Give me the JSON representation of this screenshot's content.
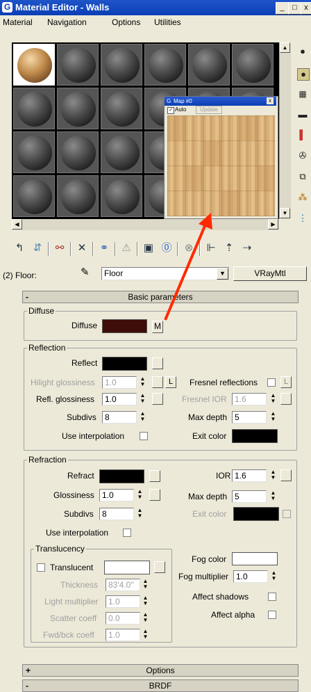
{
  "window": {
    "title": "Material Editor - Walls",
    "app_icon": "3dsmax-logo-icon"
  },
  "menu": [
    "Material",
    "Navigation",
    "Options",
    "Utilities"
  ],
  "map_window": {
    "title": "Map #0",
    "auto_label": "Auto",
    "update_label": "Update"
  },
  "material": {
    "slot_label": "(2) Floor:",
    "name": "Floor",
    "type": "VRayMtl"
  },
  "rollouts": {
    "basic": "Basic parameters",
    "options": "Options",
    "brdf": "BRDF"
  },
  "diffuse": {
    "group": "Diffuse",
    "label": "Diffuse",
    "map_button": "M",
    "color": "#3e0d09"
  },
  "reflection": {
    "group": "Reflection",
    "reflect": "Reflect",
    "hilight_glossiness": "Hilight glossiness",
    "hilight_value": "1.0",
    "lock_label": "L",
    "fresnel": "Fresnel reflections",
    "fresnel_lock": "L",
    "refl_glossiness": "Refl. glossiness",
    "refl_glossiness_value": "1.0",
    "fresnel_ior": "Fresnel IOR",
    "fresnel_ior_value": "1.6",
    "subdivs": "Subdivs",
    "subdivs_value": "8",
    "max_depth": "Max depth",
    "max_depth_value": "5",
    "use_interpolation": "Use interpolation",
    "exit_color": "Exit color"
  },
  "refraction": {
    "group": "Refraction",
    "refract": "Refract",
    "ior": "IOR",
    "ior_value": "1.6",
    "glossiness": "Glossiness",
    "glossiness_value": "1.0",
    "max_depth": "Max depth",
    "max_depth_value": "5",
    "subdivs": "Subdivs",
    "subdivs_value": "8",
    "exit_color": "Exit color",
    "use_interpolation": "Use interpolation"
  },
  "translucency": {
    "group": "Translucency",
    "translucent": "Translucent",
    "thickness": "Thickness",
    "thickness_value": "83'4.0\"",
    "light_multiplier": "Light multiplier",
    "light_multiplier_value": "1.0",
    "scatter_coeff": "Scatter coeff",
    "scatter_coeff_value": "0.0",
    "fwd_bck_coeff": "Fwd/bck coeff",
    "fwd_bck_coeff_value": "1.0",
    "fog_color": "Fog color",
    "fog_multiplier": "Fog multiplier",
    "fog_multiplier_value": "1.0",
    "affect_shadows": "Affect shadows",
    "affect_alpha": "Affect alpha"
  },
  "colors": {
    "titlebar": "#0a3fb6",
    "annotation_arrow": "#ff2a00",
    "panel_bg": "#ece9d8"
  }
}
